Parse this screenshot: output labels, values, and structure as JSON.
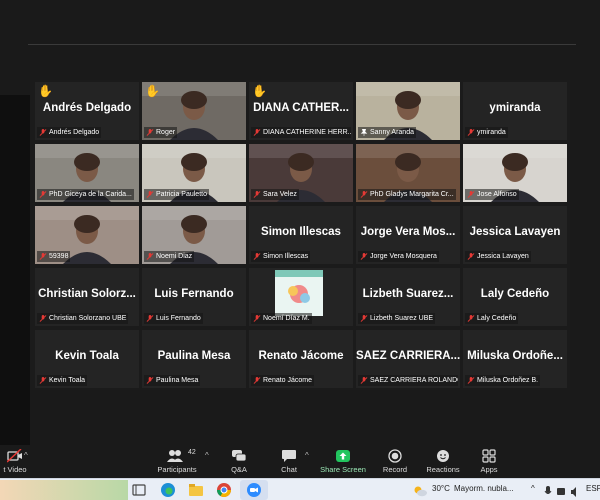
{
  "tiles": [
    {
      "name": "Andrés Delgado",
      "label": "Andrés Delgado",
      "kind": "text",
      "hand": true
    },
    {
      "name": "Roger",
      "label": "Roger",
      "kind": "video",
      "hand": true,
      "bg": "#6f6a64"
    },
    {
      "name": "DIANA CATHER...",
      "label": "DIANA CATHERINE HERR...",
      "kind": "text",
      "hand": true
    },
    {
      "name": "Sanny Aranda",
      "label": "Sanny Aranda",
      "kind": "video",
      "pin": true,
      "bg": "#b9b29e"
    },
    {
      "name": "ymiranda",
      "label": "ymiranda",
      "kind": "text"
    },
    {
      "name": "PhD Giceya",
      "label": "PhD Giceya de la Carida...",
      "kind": "video",
      "bg": "#8a8780"
    },
    {
      "name": "Patricia Pauletto",
      "label": "Patricia Pauletto",
      "kind": "video",
      "active": true,
      "bg": "#c9c6bd"
    },
    {
      "name": "Sara Velez",
      "label": "Sara Velez",
      "kind": "video",
      "bg": "#4a3a39"
    },
    {
      "name": "PhD Gladys",
      "label": "PhD Gladys Margarita Cr...",
      "kind": "video",
      "bg": "#6b4e3c"
    },
    {
      "name": "Jose Alfonso",
      "label": "Jose Alfonso",
      "kind": "video",
      "bg": "#d7d4cf"
    },
    {
      "name": "59398",
      "label": "59398",
      "kind": "video",
      "bg": "#9e8f86"
    },
    {
      "name": "Noemi Diaz",
      "label": "Noemi Diaz",
      "kind": "video",
      "bg": "#a19b97"
    },
    {
      "name": "Simon Illescas",
      "label": "Simon Illescas",
      "kind": "text"
    },
    {
      "name": "Jorge Vera Mos...",
      "label": "Jorge Vera Mosquera",
      "kind": "text"
    },
    {
      "name": "Jessica Lavayen",
      "label": "Jessica Lavayen",
      "kind": "text"
    },
    {
      "name": "Christian Solorz...",
      "label": "Christian Solorzano UBE",
      "kind": "text"
    },
    {
      "name": "Luis Fernando",
      "label": "Luis Fernando",
      "kind": "text"
    },
    {
      "name": "Noemí Díaz M.",
      "label": "Noemí Díaz M.",
      "kind": "book"
    },
    {
      "name": "Lizbeth Suarez...",
      "label": "Lizbeth Suarez UBE",
      "kind": "text"
    },
    {
      "name": "Laly Cedeño",
      "label": "Laly Cedeño",
      "kind": "text"
    },
    {
      "name": "Kevin Toala",
      "label": "Kevin Toala",
      "kind": "text"
    },
    {
      "name": "Paulina Mesa",
      "label": "Paulina Mesa",
      "kind": "text"
    },
    {
      "name": "Renato Jácome",
      "label": "Renato Jácome",
      "kind": "text"
    },
    {
      "name": "SAEZ CARRIERA...",
      "label": "SAEZ CARRIERA ROLANDO",
      "kind": "text"
    },
    {
      "name": "Miluska Ordoñe...",
      "label": "Miluska Ordoñez B.",
      "kind": "text"
    }
  ],
  "toolbar": {
    "stop_video": "t Video",
    "participants": "Participants",
    "participants_count": "42",
    "qa": "Q&A",
    "chat": "Chat",
    "share": "Share Screen",
    "record": "Record",
    "reactions": "Reactions",
    "apps": "Apps"
  },
  "taskbar": {
    "weather_temp": "30°C",
    "weather_desc": "Mayorm. nubla...",
    "lang": "ESP"
  },
  "colors": {
    "share_green": "#22c55e",
    "mute_red": "#e53935",
    "active_border": "#cde07a",
    "hand_yellow": "#f6c12b"
  }
}
